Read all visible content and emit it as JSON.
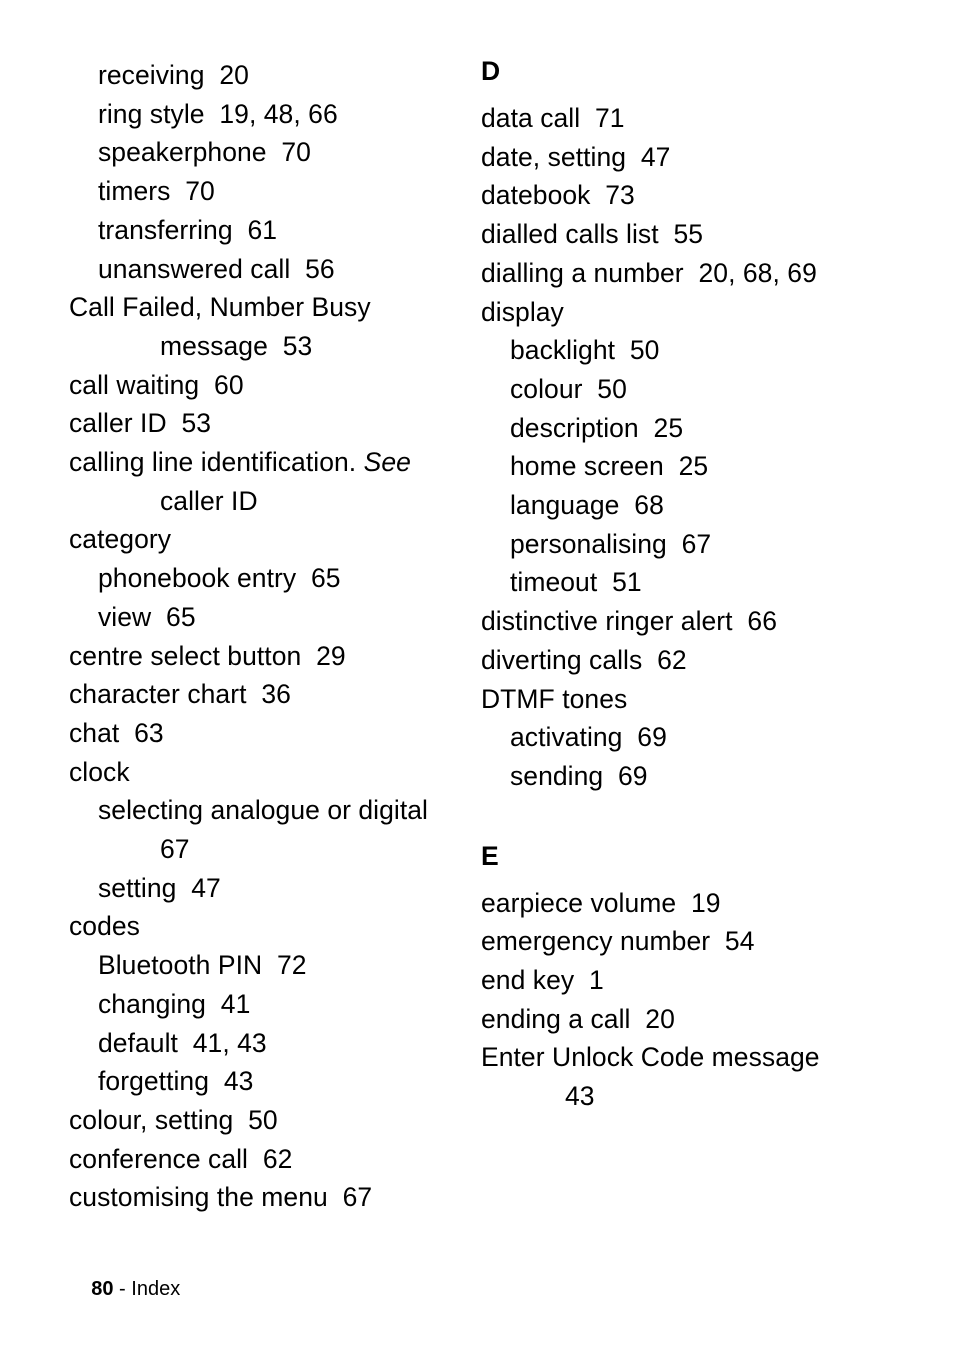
{
  "page": {
    "folio_number": "80",
    "folio_separator": " - ",
    "folio_label": "Index"
  },
  "left_column": {
    "entries": [
      {
        "level": 1,
        "text": "receiving  20"
      },
      {
        "level": 1,
        "text": "ring style  19, 48, 66"
      },
      {
        "level": 1,
        "text": "speakerphone  70"
      },
      {
        "level": 1,
        "text": "timers  70"
      },
      {
        "level": 1,
        "text": "transferring  61"
      },
      {
        "level": 1,
        "text": "unanswered call  56"
      },
      {
        "level": 0,
        "text": "Call Failed, Number Busy"
      },
      {
        "level": "cont",
        "text": "message  53"
      },
      {
        "level": 0,
        "text": "call waiting  60"
      },
      {
        "level": 0,
        "text": "caller ID  53"
      },
      {
        "level": 0,
        "text": "calling line identification. ",
        "italic_tail": "See"
      },
      {
        "level": "cont",
        "text": "caller ID"
      },
      {
        "level": 0,
        "text": "category"
      },
      {
        "level": 1,
        "text": "phonebook entry  65"
      },
      {
        "level": 1,
        "text": "view  65"
      },
      {
        "level": 0,
        "text": "centre select button  29"
      },
      {
        "level": 0,
        "text": "character chart  36"
      },
      {
        "level": 0,
        "text": "chat  63"
      },
      {
        "level": 0,
        "text": "clock"
      },
      {
        "level": 1,
        "text": "selecting analogue or digital"
      },
      {
        "level": "cont",
        "text": "67"
      },
      {
        "level": 1,
        "text": "setting  47"
      },
      {
        "level": 0,
        "text": "codes"
      },
      {
        "level": 1,
        "text": "Bluetooth PIN  72"
      },
      {
        "level": 1,
        "text": "changing  41"
      },
      {
        "level": 1,
        "text": "default  41, 43"
      },
      {
        "level": 1,
        "text": "forgetting  43"
      },
      {
        "level": 0,
        "text": "colour, setting  50"
      },
      {
        "level": 0,
        "text": "conference call  62"
      },
      {
        "level": 0,
        "text": "customising the menu  67"
      }
    ]
  },
  "right_column": {
    "sections": [
      {
        "heading": "D",
        "first": true,
        "entries": [
          {
            "level": 0,
            "text": "data call  71"
          },
          {
            "level": 0,
            "text": "date, setting  47"
          },
          {
            "level": 0,
            "text": "datebook  73"
          },
          {
            "level": 0,
            "text": "dialled calls list  55"
          },
          {
            "level": 0,
            "text": "dialling a number  20, 68, 69"
          },
          {
            "level": 0,
            "text": "display"
          },
          {
            "level": 1,
            "text": "backlight  50"
          },
          {
            "level": 1,
            "text": "colour  50"
          },
          {
            "level": 1,
            "text": "description  25"
          },
          {
            "level": 1,
            "text": "home screen  25"
          },
          {
            "level": 1,
            "text": "language  68"
          },
          {
            "level": 1,
            "text": "personalising  67"
          },
          {
            "level": 1,
            "text": "timeout  51"
          },
          {
            "level": 0,
            "text": "distinctive ringer alert  66"
          },
          {
            "level": 0,
            "text": "diverting calls  62"
          },
          {
            "level": 0,
            "text": "DTMF tones"
          },
          {
            "level": 1,
            "text": "activating  69"
          },
          {
            "level": 1,
            "text": "sending  69"
          }
        ]
      },
      {
        "heading": "E",
        "first": false,
        "entries": [
          {
            "level": 0,
            "text": "earpiece volume  19"
          },
          {
            "level": 0,
            "text": "emergency number  54"
          },
          {
            "level": 0,
            "text": "end key  1"
          },
          {
            "level": 0,
            "text": "ending a call  20"
          },
          {
            "level": 0,
            "text": "Enter Unlock Code message"
          },
          {
            "level": "cont",
            "text": "43"
          }
        ]
      }
    ]
  }
}
